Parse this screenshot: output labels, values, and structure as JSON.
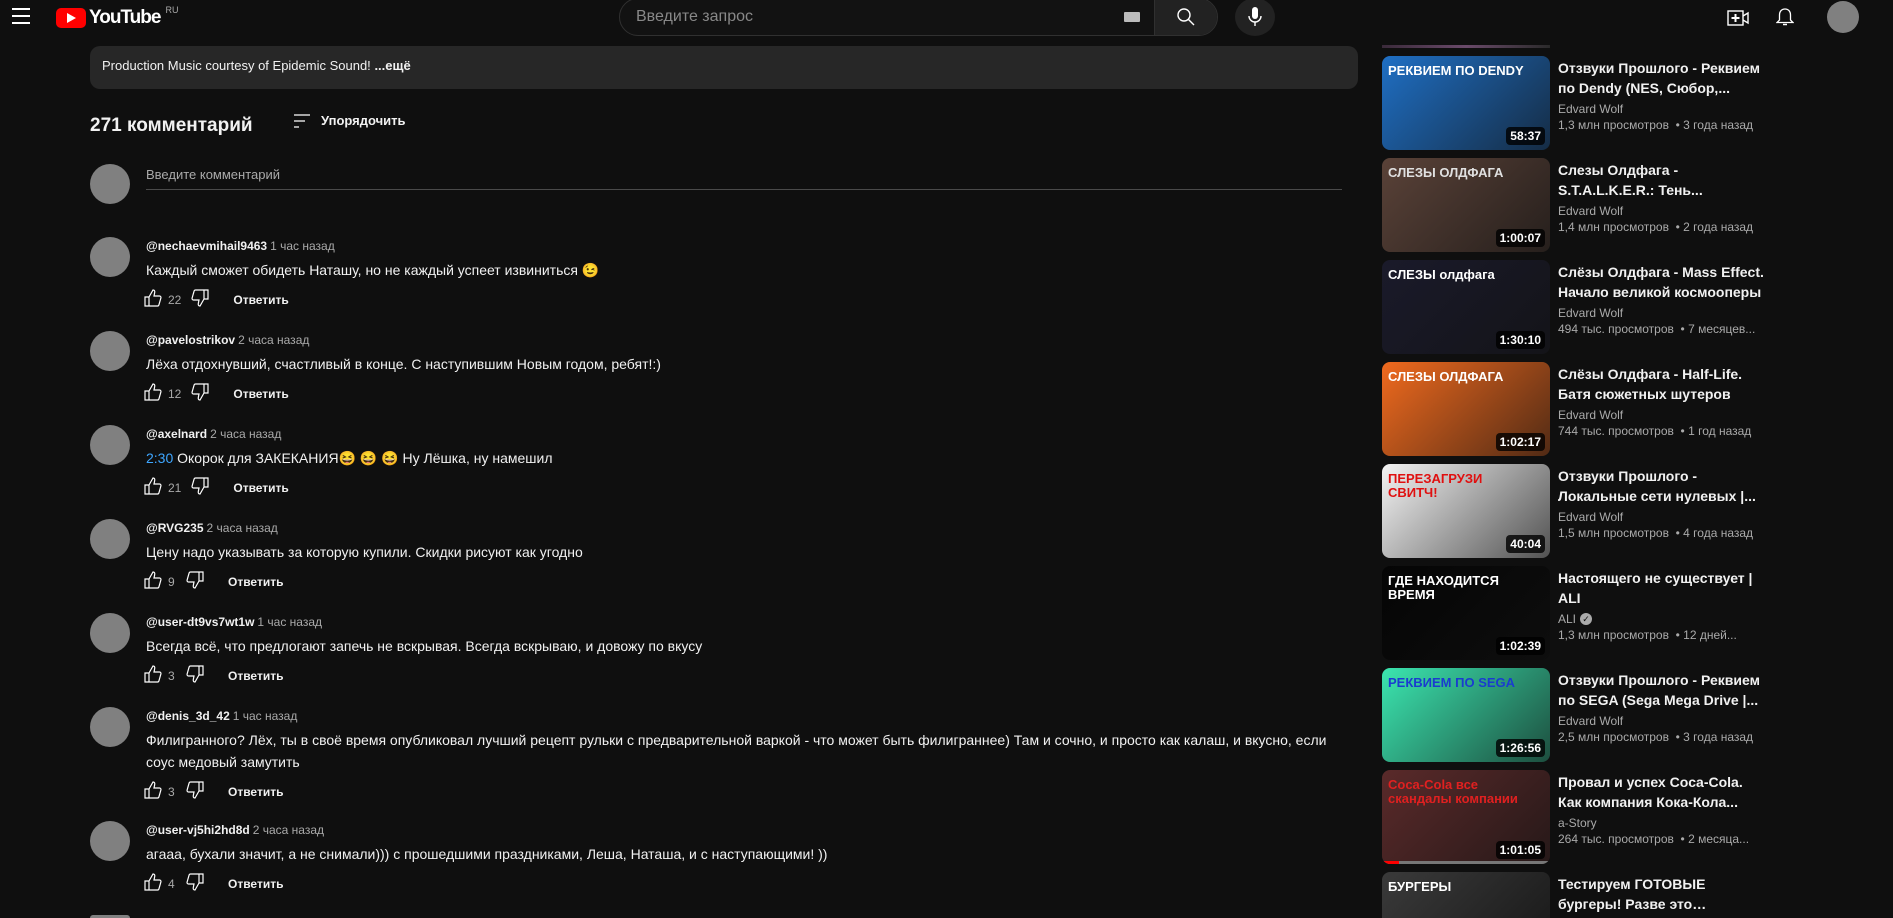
{
  "header": {
    "logo_text": "YouTube",
    "country_code": "RU",
    "search_placeholder": "Введите запрос"
  },
  "description": {
    "text": "Production Music courtesy of Epidemic Sound!",
    "more_label": "...ещё"
  },
  "comments_section": {
    "count_label": "271 комментарий",
    "sort_label": "Упорядочить",
    "input_placeholder": "Введите комментарий",
    "reply_label": "Ответить"
  },
  "comments": [
    {
      "author": "@nechaevmihail9463",
      "time": "1 час назад",
      "timestamp": "",
      "text": "Каждый сможет обидеть Наташу, но не каждый успеет извиниться 😉",
      "likes": "22"
    },
    {
      "author": "@pavelostrikov",
      "time": "2 часа назад",
      "timestamp": "",
      "text": "Лёха отдохнувший, счастливый в конце. С наступившим Новым годом, ребят!:)",
      "likes": "12"
    },
    {
      "author": "@axelnard",
      "time": "2 часа назад",
      "timestamp": "2:30",
      "text": " Окорок для ЗАКЕКАНИЯ😆 😆 😆 Ну Лёшка, ну намешил",
      "likes": "21"
    },
    {
      "author": "@RVG235",
      "time": "2 часа назад",
      "timestamp": "",
      "text": "Цену надо указывать за которую купили. Скидки рисуют как угодно",
      "likes": "9"
    },
    {
      "author": "@user-dt9vs7wt1w",
      "time": "1 час назад",
      "timestamp": "",
      "text": "Всегда всё, что предлогают запечь не вскрывая. Всегда вскрываю, и довожу по вкусу",
      "likes": "3"
    },
    {
      "author": "@denis_3d_42",
      "time": "1 час назад",
      "timestamp": "",
      "text": "Филигранного? Лёх, ты в своё время опубликовал лучший рецепт рульки с предварительной варкой - что может быть филиграннее) Там и сочно, и просто как калаш, и вкусно, если соус медовый замутить",
      "likes": "3"
    },
    {
      "author": "@user-vj5hi2hd8d",
      "time": "2 часа назад",
      "timestamp": "",
      "text": "агааа, бухали значит, а не снимали))) с прошедшими праздниками, Леша, Наташа, и с наступающими! ))",
      "likes": "4"
    }
  ],
  "recommendations": [
    {
      "title": "Отзвуки Прошлого - Реквием по Dendy (NES, Сюбор,...",
      "channel": "Edvard Wolf",
      "verified": false,
      "views": "1,3 млн просмотров",
      "age": "3 года назад",
      "duration": "58:37",
      "thumb_text": "РЕКВИЕМ ПО DENDY",
      "thumb_bg": "#1f6fc4",
      "thumb_fg": "#ffffff"
    },
    {
      "title": "Слезы Олдфага - S.T.A.L.K.E.R.: Тень...",
      "channel": "Edvard Wolf",
      "verified": false,
      "views": "1,4 млн просмотров",
      "age": "2 года назад",
      "duration": "1:00:07",
      "thumb_text": "СЛЕЗЫ ОЛДФАГА",
      "thumb_bg": "#5a4238",
      "thumb_fg": "#e0e0e0"
    },
    {
      "title": "Слёзы Олдфага - Mass Effect. Начало великой космооперы",
      "channel": "Edvard Wolf",
      "verified": false,
      "views": "494 тыс. просмотров",
      "age": "7 месяцев...",
      "duration": "1:30:10",
      "thumb_text": "СЛЕЗЫ олдфага",
      "thumb_bg": "#1a1a2a",
      "thumb_fg": "#ffffff"
    },
    {
      "title": "Слёзы Олдфага - Half-Life. Батя сюжетных шутеров",
      "channel": "Edvard Wolf",
      "verified": false,
      "views": "744 тыс. просмотров",
      "age": "1 год назад",
      "duration": "1:02:17",
      "thumb_text": "СЛЕЗЫ ОЛДФАГА",
      "thumb_bg": "#f06a1e",
      "thumb_fg": "#ffffff"
    },
    {
      "title": "Отзвуки Прошлого - Локальные сети нулевых |...",
      "channel": "Edvard Wolf",
      "verified": false,
      "views": "1,5 млн просмотров",
      "age": "4 года назад",
      "duration": "40:04",
      "thumb_text": "ПЕРЕЗАГРУЗИ СВИТЧ!",
      "thumb_bg": "#f4f4f4",
      "thumb_fg": "#e01010"
    },
    {
      "title": "Настоящего не существует | ALI",
      "channel": "ALI",
      "verified": true,
      "views": "1,3 млн просмотров",
      "age": "12 дней...",
      "duration": "1:02:39",
      "thumb_text": "ГДЕ НАХОДИТСЯ ВРЕМЯ",
      "thumb_bg": "#050505",
      "thumb_fg": "#ffffff"
    },
    {
      "title": "Отзвуки Прошлого - Реквием по SEGA (Sega Mega Drive |...",
      "channel": "Edvard Wolf",
      "verified": false,
      "views": "2,5 млн просмотров",
      "age": "3 года назад",
      "duration": "1:26:56",
      "thumb_text": "РЕКВИЕМ ПО SEGA",
      "thumb_bg": "#3be6b0",
      "thumb_fg": "#1a3ccf"
    },
    {
      "title": "Провал и успех Coca-Cola. Как компания Кока-Кола...",
      "channel": "a-Story",
      "verified": false,
      "views": "264 тыс. просмотров",
      "age": "2 месяца...",
      "duration": "1:01:05",
      "thumb_text": "Coca-Cola все скандалы компании",
      "thumb_bg": "#5a2a2a",
      "thumb_fg": "#e02020",
      "progress": 0.1
    },
    {
      "title": "Тестируем ГОТОВЫЕ бургеры! Разве это съедобно?!",
      "channel": "",
      "verified": false,
      "views": "",
      "age": "",
      "duration": "",
      "thumb_text": "БУРГЕРЫ",
      "thumb_bg": "#3a3a3a",
      "thumb_fg": "#ffffff"
    }
  ]
}
